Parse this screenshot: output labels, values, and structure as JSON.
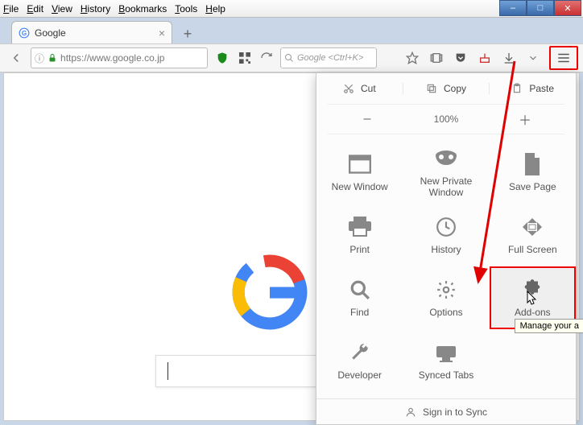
{
  "menubar": [
    "File",
    "Edit",
    "View",
    "History",
    "Bookmarks",
    "Tools",
    "Help"
  ],
  "window_controls": {
    "minimize": "–",
    "maximize": "□",
    "close": "✕"
  },
  "tab": {
    "title": "Google",
    "favicon_letter": "G"
  },
  "toolbar": {
    "url": "https://www.google.co.jp",
    "search_placeholder": "Google <Ctrl+K>"
  },
  "page": {},
  "menu": {
    "edit": {
      "cut": "Cut",
      "copy": "Copy",
      "paste": "Paste"
    },
    "zoom": {
      "minus": "–",
      "pct": "100%",
      "plus": "＋"
    },
    "items": [
      {
        "id": "new-window",
        "label": "New Window"
      },
      {
        "id": "new-private",
        "label": "New Private Window"
      },
      {
        "id": "save-page",
        "label": "Save Page"
      },
      {
        "id": "print",
        "label": "Print"
      },
      {
        "id": "history",
        "label": "History"
      },
      {
        "id": "fullscreen",
        "label": "Full Screen"
      },
      {
        "id": "find",
        "label": "Find"
      },
      {
        "id": "options",
        "label": "Options"
      },
      {
        "id": "addons",
        "label": "Add-ons"
      },
      {
        "id": "developer",
        "label": "Developer"
      },
      {
        "id": "synced",
        "label": "Synced Tabs"
      }
    ],
    "tooltip": "Manage your a",
    "signin": "Sign in to Sync"
  },
  "annotation": {
    "color": "#e00000"
  }
}
